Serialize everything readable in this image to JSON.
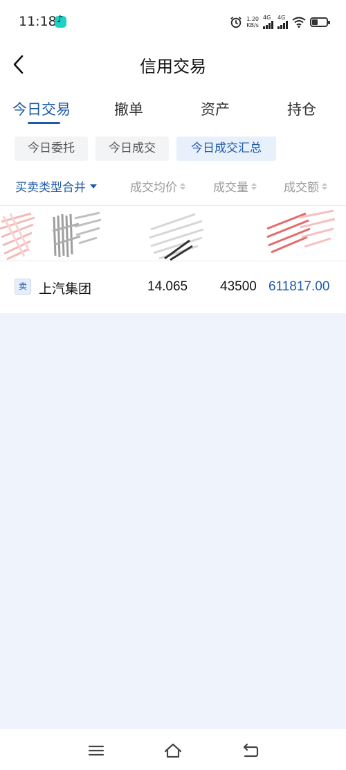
{
  "status_bar": {
    "time": "11:18",
    "net_speed_value": "1.20",
    "net_speed_unit": "KB/s",
    "sim1_label": "4G",
    "sim2_label": "4G",
    "icons": [
      "tiktok-app-icon",
      "alarm-icon",
      "signal-icon",
      "wifi-icon",
      "battery-icon"
    ]
  },
  "header": {
    "title": "信用交易",
    "back_icon": "chevron-left-icon"
  },
  "tabs": [
    {
      "label": "今日交易",
      "active": true
    },
    {
      "label": "撤单",
      "active": false
    },
    {
      "label": "资产",
      "active": false
    },
    {
      "label": "持仓",
      "active": false
    }
  ],
  "subtabs": [
    {
      "label": "今日委托",
      "active": false
    },
    {
      "label": "今日成交",
      "active": false
    },
    {
      "label": "今日成交汇总",
      "active": true
    }
  ],
  "columns": {
    "type_filter": "买卖类型合并",
    "avg_price": "成交均价",
    "volume": "成交量",
    "amount": "成交额"
  },
  "rows": [
    {
      "side": "卖",
      "name": "上汽集团",
      "avg_price": "14.065",
      "volume": "43500",
      "amount": "611817.00"
    }
  ],
  "nav_bar": {
    "icons": [
      "menu-icon",
      "home-icon",
      "back-nav-icon"
    ]
  },
  "colors": {
    "accent": "#1e5aa8",
    "page_bg": "#eff3fc",
    "redaction_red": "#e05050",
    "redaction_gray": "#8a8a8a"
  }
}
